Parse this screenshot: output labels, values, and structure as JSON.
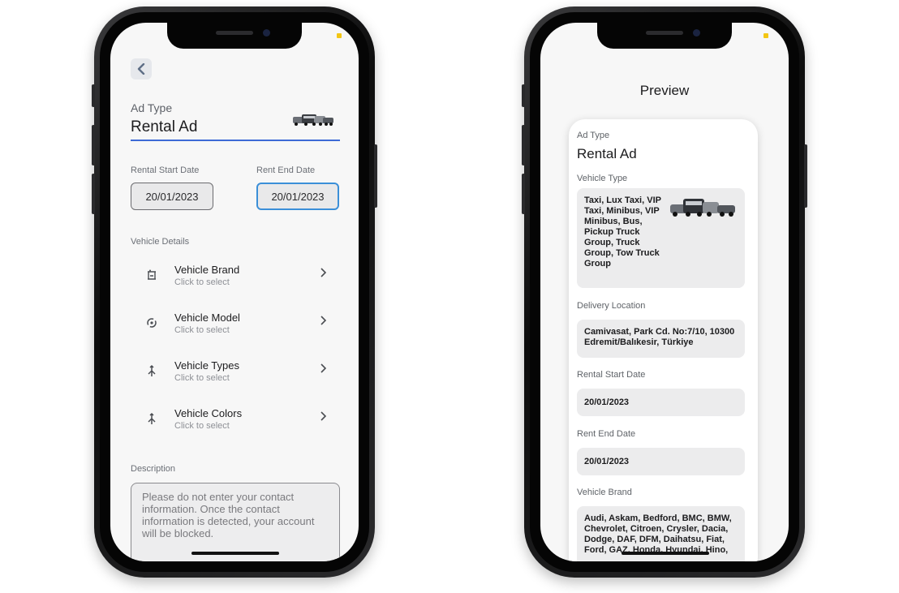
{
  "form": {
    "ad_type_label": "Ad Type",
    "ad_type_value": "Rental Ad",
    "rental_start_label": "Rental Start Date",
    "rental_start_value": "20/01/2023",
    "rent_end_label": "Rent End Date",
    "rent_end_value": "20/01/2023",
    "vehicle_details_label": "Vehicle Details",
    "details": [
      {
        "title": "Vehicle Brand",
        "subtitle": "Click to select",
        "icon": "car-seat-icon"
      },
      {
        "title": "Vehicle Model",
        "subtitle": "Click to select",
        "icon": "rotate-icon"
      },
      {
        "title": "Vehicle Types",
        "subtitle": "Click to select",
        "icon": "merge-icon"
      },
      {
        "title": "Vehicle Colors",
        "subtitle": "Click to select",
        "icon": "merge-icon"
      }
    ],
    "description_label": "Description",
    "description_placeholder": "Please do not enter your contact information. Once the contact information is detected, your account will be blocked."
  },
  "preview": {
    "title": "Preview",
    "ad_type_label": "Ad Type",
    "ad_type_value": "Rental Ad",
    "vehicle_type_label": "Vehicle Type",
    "vehicle_type_value": "Taxi, Lux Taxi, VIP Taxi, Minibus, VIP Minibus, Bus, Pickup Truck Group, Truck Group, Tow Truck Group",
    "delivery_location_label": "Delivery Location",
    "delivery_location_value": "Camivasat, Park Cd. No:7/10, 10300 Edremit/Balıkesir, Türkiye",
    "rental_start_label": "Rental Start Date",
    "rental_start_value": "20/01/2023",
    "rent_end_label": "Rent End Date",
    "rent_end_value": "20/01/2023",
    "vehicle_brand_label": "Vehicle Brand",
    "vehicle_brand_value": "Audi, Askam, Bedford, BMC, BMW, Chevrolet, Citroen, Crysler, Dacia, Dodge, DAF, DFM, Daihatsu, Fiat, Ford, GAZ, Honda, Hyundai, Hino,"
  },
  "colors": {
    "accent_blue": "#3d6ad6",
    "focus_border": "#3b8fd8",
    "status_yellow": "#f3c614"
  }
}
